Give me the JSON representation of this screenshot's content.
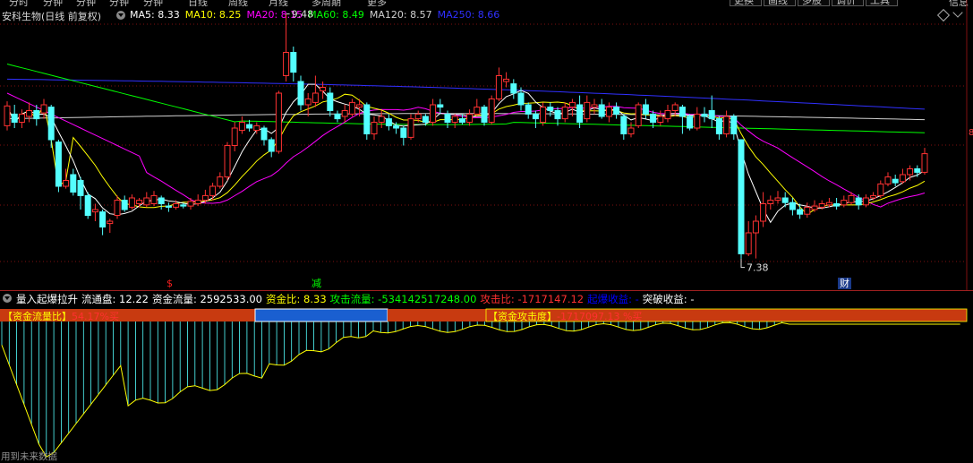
{
  "menu": {
    "left_items": [
      "分时",
      "分钟",
      "分钟",
      "分钟",
      "分钟",
      "日线",
      "周线",
      "月线",
      "多周期",
      "更多"
    ],
    "right_items": [
      "更换",
      "画线",
      "多股",
      "调价",
      "工具"
    ],
    "right_end": "信息"
  },
  "stock": {
    "title": "安科生物(日线 前复权)",
    "ma_legend": [
      {
        "label": "MA5: 8.33",
        "color": "#ffffff"
      },
      {
        "label": "MA10: 8.25",
        "color": "#ffff00"
      },
      {
        "label": "MA20: 8.15",
        "color": "#ff00ff"
      },
      {
        "label": "MA60: 8.49",
        "color": "#00ff00"
      },
      {
        "label": "MA120: 8.57",
        "color": "#d0d0d0"
      },
      {
        "label": "MA250: 8.66",
        "color": "#3030ff"
      }
    ],
    "high_label": "9.48",
    "low_label": "7.38",
    "axis_tag": "8"
  },
  "event_markers": [
    {
      "label": "$",
      "color": "#ff2020"
    },
    {
      "label": "减",
      "color": "#00ff00"
    },
    {
      "label": "财",
      "color": "#ffffff",
      "bg": "#1a3a8a"
    }
  ],
  "candles": [
    [
      8.52,
      8.69,
      8.73,
      8.48
    ],
    [
      8.62,
      8.55,
      8.7,
      8.5
    ],
    [
      8.55,
      8.62,
      8.66,
      8.5
    ],
    [
      8.6,
      8.65,
      8.72,
      8.55
    ],
    [
      8.65,
      8.58,
      8.7,
      8.52
    ],
    [
      8.63,
      8.7,
      8.75,
      8.58
    ],
    [
      8.68,
      8.4,
      8.7,
      8.33
    ],
    [
      8.38,
      8.0,
      8.4,
      7.95
    ],
    [
      8.0,
      8.05,
      8.15,
      7.98
    ],
    [
      8.1,
      7.95,
      8.15,
      7.92
    ],
    [
      8.05,
      7.92,
      8.08,
      7.8
    ],
    [
      7.92,
      7.75,
      7.95,
      7.72
    ],
    [
      7.78,
      7.8,
      7.85,
      7.7
    ],
    [
      7.78,
      7.65,
      7.8,
      7.58
    ],
    [
      7.68,
      7.7,
      7.72,
      7.6
    ],
    [
      7.75,
      7.88,
      7.92,
      7.72
    ],
    [
      7.88,
      7.8,
      7.92,
      7.78
    ],
    [
      7.82,
      7.9,
      7.93,
      7.8
    ],
    [
      7.85,
      7.88,
      7.9,
      7.82
    ],
    [
      7.84,
      7.9,
      7.95,
      7.82
    ],
    [
      7.85,
      7.92,
      7.96,
      7.83
    ],
    [
      7.9,
      7.85,
      7.92,
      7.8
    ],
    [
      7.83,
      7.82,
      7.86,
      7.78
    ],
    [
      7.82,
      7.85,
      7.88,
      7.8
    ],
    [
      7.84,
      7.83,
      7.86,
      7.81
    ],
    [
      7.83,
      7.87,
      7.9,
      7.8
    ],
    [
      7.85,
      7.88,
      7.93,
      7.83
    ],
    [
      7.88,
      7.92,
      7.97,
      7.85
    ],
    [
      7.92,
      8.0,
      8.03,
      7.88
    ],
    [
      8.0,
      8.08,
      8.12,
      7.98
    ],
    [
      8.08,
      8.35,
      8.38,
      8.05
    ],
    [
      8.35,
      8.5,
      8.55,
      8.3
    ],
    [
      8.48,
      8.55,
      8.6,
      8.45
    ],
    [
      8.53,
      8.5,
      8.57,
      8.47
    ],
    [
      8.48,
      8.52,
      8.55,
      8.45
    ],
    [
      8.5,
      8.4,
      8.52,
      8.35
    ],
    [
      8.4,
      8.3,
      8.42,
      8.25
    ],
    [
      8.3,
      8.8,
      8.82,
      8.28
    ],
    [
      8.95,
      9.15,
      9.48,
      8.9
    ],
    [
      9.15,
      8.98,
      9.2,
      8.9
    ],
    [
      8.9,
      8.7,
      8.95,
      8.65
    ],
    [
      8.7,
      8.75,
      8.8,
      8.6
    ],
    [
      8.72,
      8.8,
      8.95,
      8.68
    ],
    [
      8.82,
      8.85,
      8.9,
      8.75
    ],
    [
      8.8,
      8.65,
      8.85,
      8.6
    ],
    [
      8.62,
      8.58,
      8.65,
      8.55
    ],
    [
      8.6,
      8.65,
      8.7,
      8.55
    ],
    [
      8.62,
      8.72,
      8.75,
      8.6
    ],
    [
      8.68,
      8.7,
      8.75,
      8.6
    ],
    [
      8.7,
      8.45,
      8.72,
      8.4
    ],
    [
      8.45,
      8.55,
      8.6,
      8.4
    ],
    [
      8.55,
      8.6,
      8.65,
      8.5
    ],
    [
      8.58,
      8.52,
      8.62,
      8.48
    ],
    [
      8.52,
      8.5,
      8.55,
      8.45
    ],
    [
      8.5,
      8.42,
      8.52,
      8.35
    ],
    [
      8.42,
      8.58,
      8.62,
      8.4
    ],
    [
      8.58,
      8.62,
      8.65,
      8.55
    ],
    [
      8.6,
      8.55,
      8.62,
      8.52
    ],
    [
      8.55,
      8.7,
      8.75,
      8.52
    ],
    [
      8.7,
      8.68,
      8.75,
      8.62
    ],
    [
      8.62,
      8.55,
      8.65,
      8.5
    ],
    [
      8.55,
      8.6,
      8.62,
      8.5
    ],
    [
      8.58,
      8.55,
      8.62,
      8.53
    ],
    [
      8.55,
      8.62,
      8.66,
      8.52
    ],
    [
      8.62,
      8.68,
      8.75,
      8.6
    ],
    [
      8.68,
      8.55,
      8.7,
      8.52
    ],
    [
      8.55,
      8.75,
      8.78,
      8.53
    ],
    [
      8.75,
      8.95,
      9.02,
      8.73
    ],
    [
      8.9,
      8.92,
      8.98,
      8.85
    ],
    [
      8.88,
      8.8,
      8.92,
      8.75
    ],
    [
      8.8,
      8.7,
      8.85,
      8.65
    ],
    [
      8.7,
      8.62,
      8.72,
      8.58
    ],
    [
      8.62,
      8.58,
      8.65,
      8.5
    ],
    [
      8.55,
      8.68,
      8.72,
      8.52
    ],
    [
      8.68,
      8.65,
      8.72,
      8.6
    ],
    [
      8.65,
      8.58,
      8.68,
      8.52
    ],
    [
      8.58,
      8.68,
      8.72,
      8.55
    ],
    [
      8.68,
      8.72,
      8.75,
      8.6
    ],
    [
      8.7,
      8.55,
      8.78,
      8.5
    ],
    [
      8.58,
      8.72,
      8.78,
      8.55
    ],
    [
      8.68,
      8.7,
      8.75,
      8.62
    ],
    [
      8.7,
      8.6,
      8.75,
      8.58
    ],
    [
      8.6,
      8.68,
      8.72,
      8.55
    ],
    [
      8.68,
      8.62,
      8.72,
      8.58
    ],
    [
      8.6,
      8.45,
      8.62,
      8.4
    ],
    [
      8.45,
      8.5,
      8.55,
      8.42
    ],
    [
      8.52,
      8.7,
      8.72,
      8.5
    ],
    [
      8.7,
      8.62,
      8.75,
      8.58
    ],
    [
      8.62,
      8.55,
      8.65,
      8.5
    ],
    [
      8.55,
      8.6,
      8.65,
      8.52
    ],
    [
      8.58,
      8.65,
      8.7,
      8.55
    ],
    [
      8.65,
      8.7,
      8.72,
      8.6
    ],
    [
      8.68,
      8.6,
      8.7,
      8.45
    ],
    [
      8.6,
      8.5,
      8.62,
      8.48
    ],
    [
      8.5,
      8.62,
      8.68,
      8.48
    ],
    [
      8.62,
      8.6,
      8.68,
      8.55
    ],
    [
      8.65,
      8.58,
      8.78,
      8.5
    ],
    [
      8.58,
      8.45,
      8.6,
      8.4
    ],
    [
      8.45,
      8.6,
      8.65,
      8.42
    ],
    [
      8.6,
      8.45,
      8.62,
      8.4
    ],
    [
      8.4,
      7.42,
      8.3,
      7.38
    ],
    [
      7.42,
      7.6,
      7.7,
      7.4
    ],
    [
      7.6,
      7.7,
      7.75,
      7.38
    ],
    [
      7.7,
      7.85,
      7.95,
      7.65
    ],
    [
      7.85,
      7.88,
      7.92,
      7.8
    ],
    [
      7.88,
      7.9,
      7.96,
      7.85
    ],
    [
      7.9,
      7.86,
      7.95,
      7.82
    ],
    [
      7.86,
      7.8,
      7.9,
      7.75
    ],
    [
      7.8,
      7.76,
      7.85,
      7.72
    ],
    [
      7.76,
      7.82,
      7.86,
      7.73
    ],
    [
      7.8,
      7.83,
      7.88,
      7.78
    ],
    [
      7.82,
      7.85,
      7.88,
      7.8
    ],
    [
      7.84,
      7.86,
      7.9,
      7.82
    ],
    [
      7.85,
      7.83,
      7.9,
      7.8
    ],
    [
      7.84,
      7.88,
      7.92,
      7.82
    ],
    [
      7.86,
      7.92,
      7.95,
      7.84
    ],
    [
      7.9,
      7.84,
      7.93,
      7.8
    ],
    [
      7.84,
      7.9,
      7.93,
      7.82
    ],
    [
      7.9,
      7.92,
      7.95,
      7.88
    ],
    [
      7.92,
      8.02,
      8.05,
      7.9
    ],
    [
      8.02,
      8.08,
      8.12,
      8.0
    ],
    [
      8.06,
      8.03,
      8.1,
      8.0
    ],
    [
      8.04,
      8.1,
      8.15,
      8.02
    ],
    [
      8.1,
      8.15,
      8.18,
      8.05
    ],
    [
      8.15,
      8.12,
      8.18,
      8.08
    ],
    [
      8.12,
      8.28,
      8.33,
      8.1
    ]
  ],
  "indicator": {
    "name": "量入起爆拉升",
    "fields": [
      {
        "label": "流通盘: 12.22",
        "color": "#ffffff"
      },
      {
        "label": "资金流量: 2592533.00",
        "color": "#ffffff"
      },
      {
        "label": "资金比: 8.33",
        "color": "#ffff00"
      },
      {
        "label": "攻击流量: -534142517248.00",
        "color": "#00ff00"
      },
      {
        "label": "攻击比: -1717147.12",
        "color": "#ff3030"
      },
      {
        "label": "起爆收益: -",
        "color": "#0000ff"
      },
      {
        "label": "突破收益: -",
        "color": "#ffffff"
      }
    ],
    "fund_bar_label": "【资金流量比】",
    "fund_bar_value": "54.17%买",
    "attack_bar_label": "【资金攻击度】",
    "attack_bar_value": "-1717097.13 %买",
    "bar_colors": {
      "red": "#c83a10",
      "blue": "#1a5fd0"
    },
    "footer": "用到未来数据"
  },
  "colors": {
    "up": "#ff3232",
    "down": "#54ffff",
    "grid": "#801010",
    "ma5": "#ffffff",
    "ma10": "#ffff00",
    "ma20": "#ff00ff",
    "ma60": "#00ff00",
    "ma120": "#d0d0d0",
    "ma250": "#3030ff"
  }
}
